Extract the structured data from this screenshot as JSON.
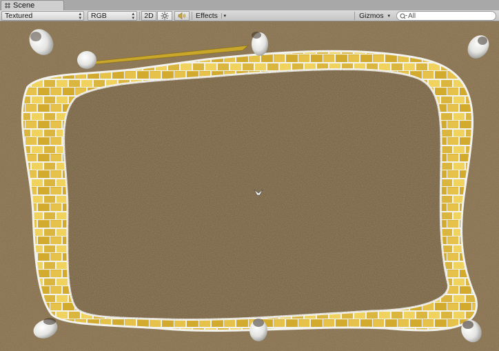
{
  "window": {
    "tab_title": "Scene"
  },
  "toolbar": {
    "render_mode": "Textured",
    "color_mode": "RGB",
    "mode_2d_label": "2D",
    "effects_label": "Effects",
    "gizmos_label": "Gizmos",
    "search_placeholder": "All"
  },
  "colors": {
    "ground": "#8a7350",
    "ground_inner": "#7d6848",
    "brick_yellow": "#d9b234",
    "brick_highlight": "#f4de6e",
    "mortar": "#f2f2ee",
    "post_white": "#ececea",
    "laser": "#c9a72a"
  },
  "icons": [
    "grid-icon",
    "sun-icon",
    "audio-icon",
    "search-icon",
    "camera-pivot-icon"
  ]
}
